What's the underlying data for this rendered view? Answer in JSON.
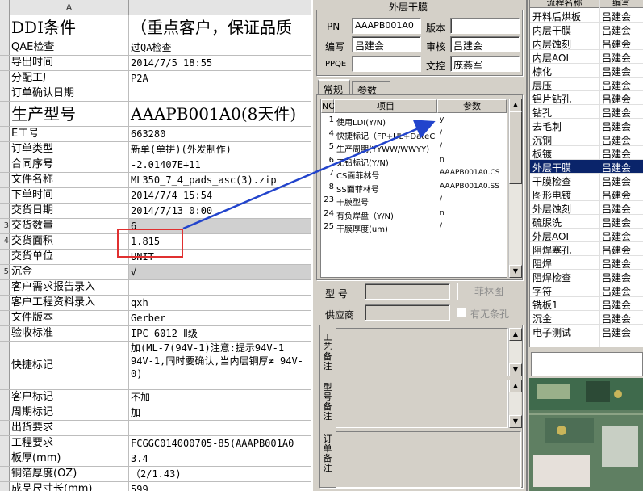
{
  "sheet": {
    "column_header": "A",
    "rows": [
      {
        "num": "",
        "label": "DDI条件",
        "value": "（重点客户，保证品质",
        "style": "big"
      },
      {
        "num": "",
        "label": "QAE检查",
        "value": "过QA检查"
      },
      {
        "num": "",
        "label": "导出时间",
        "value": "2014/7/5 18:55"
      },
      {
        "num": "",
        "label": "分配工厂",
        "value": "P2A"
      },
      {
        "num": "",
        "label": "订单确认日期",
        "value": ""
      },
      {
        "num": "",
        "label": "生产型号",
        "value": "AAAPB001A0(8天件)",
        "style": "big"
      },
      {
        "num": "",
        "label": "E工号",
        "value": "663280"
      },
      {
        "num": "",
        "label": "订单类型",
        "value": "新单(单拼)(外发制作)"
      },
      {
        "num": "",
        "label": "合同序号",
        "value": "-2.01407E+11"
      },
      {
        "num": "",
        "label": "文件名称",
        "value": "ML350_7_4_pads_asc(3).zip"
      },
      {
        "num": "",
        "label": "下单时间",
        "value": "2014/7/4 15:54"
      },
      {
        "num": "",
        "label": "交货日期",
        "value": "2014/7/13 0:00"
      },
      {
        "num": "3",
        "label": "交货数量",
        "value": "6",
        "style": "gray"
      },
      {
        "num": "4",
        "label": "交货面积",
        "value": "1.815"
      },
      {
        "num": "",
        "label": "交货单位",
        "value": "UNIT"
      },
      {
        "num": "5",
        "label": "沉金",
        "value": "√",
        "style": "gray"
      },
      {
        "num": "",
        "label": "客户需求报告录入",
        "value": ""
      },
      {
        "num": "",
        "label": "客户工程资料录入",
        "value": "qxh"
      },
      {
        "num": "",
        "label": "文件版本",
        "value": "Gerber"
      },
      {
        "num": "",
        "label": "验收标准",
        "value": "IPC-6012 Ⅱ级"
      },
      {
        "num": "",
        "label": "快捷标记",
        "value": "加(ML-7(94V-1)注意:提示94V-1 94V-1,同时要确认,当内层铜厚≠ 94V-0)",
        "style": "tall"
      },
      {
        "num": "",
        "label": "客户标记",
        "value": "不加"
      },
      {
        "num": "",
        "label": "周期标记",
        "value": "加"
      },
      {
        "num": "",
        "label": "出货要求",
        "value": ""
      },
      {
        "num": "",
        "label": "工程要求",
        "value": "FCGGC014000705-85(AAAPB001A0"
      },
      {
        "num": "",
        "label": "板厚(mm)",
        "value": "3.4"
      },
      {
        "num": "",
        "label": "铜箔厚度(OZ)",
        "value": "（2/1.43)"
      },
      {
        "num": "",
        "label": "成品尺寸长(mm)",
        "value": "599"
      }
    ]
  },
  "dialog": {
    "title": "外层干膜",
    "pn_label": "PN",
    "pn_value": "AAAPB001A0",
    "version_label": "版本",
    "version_value": "",
    "editor_label": "编写",
    "editor_value": "吕建会",
    "reviewer_label": "审核",
    "reviewer_value": "吕建会",
    "ppqe_label": "PPQE",
    "ppqe_value": "",
    "proof_label": "文控",
    "proof_value": "庞燕军",
    "tabs": [
      "常规",
      "参数"
    ],
    "grid": {
      "headers": [
        "NO",
        "项目",
        "参数"
      ],
      "rows": [
        {
          "no": "1",
          "item": "使用LDI(Y/N)",
          "param": "y"
        },
        {
          "no": "4",
          "item": "快捷标记（FP+UL+DateC",
          "param": "/"
        },
        {
          "no": "5",
          "item": "生产周期(YYWW/WWYY)",
          "param": "/"
        },
        {
          "no": "6",
          "item": "无铅标记(Y/N)",
          "param": "n"
        },
        {
          "no": "7",
          "item": "CS面菲林号",
          "param": "AAAPB001A0.CS"
        },
        {
          "no": "8",
          "item": "SS面菲林号",
          "param": "AAAPB001A0.SS"
        },
        {
          "no": "23",
          "item": "干膜型号",
          "param": "/"
        },
        {
          "no": "24",
          "item": "有负焊盘（Y/N)",
          "param": "n"
        },
        {
          "no": "25",
          "item": "干膜厚度(um)",
          "param": "/"
        }
      ]
    },
    "model_label": "型  号",
    "supplier_label": "供应商",
    "film_button": "菲林图",
    "no_strip_label": "有无条孔",
    "memo_labels": [
      "工艺备注",
      "型号备注",
      "订单备注"
    ]
  },
  "process": {
    "headers": [
      "流程名称",
      "编写"
    ],
    "rows": [
      {
        "name": "开料后烘板",
        "author": "吕建会"
      },
      {
        "name": "内层干膜",
        "author": "吕建会"
      },
      {
        "name": "内层蚀刻",
        "author": "吕建会"
      },
      {
        "name": "内层AOI",
        "author": "吕建会"
      },
      {
        "name": "棕化",
        "author": "吕建会"
      },
      {
        "name": "层压",
        "author": "吕建会"
      },
      {
        "name": "铝片钻孔",
        "author": "吕建会"
      },
      {
        "name": "钻孔",
        "author": "吕建会"
      },
      {
        "name": "去毛刺",
        "author": "吕建会"
      },
      {
        "name": "沉铜",
        "author": "吕建会"
      },
      {
        "name": "板镀",
        "author": "吕建会"
      },
      {
        "name": "外层干膜",
        "author": "吕建会",
        "selected": true
      },
      {
        "name": "干膜检查",
        "author": "吕建会"
      },
      {
        "name": "图形电镀",
        "author": "吕建会"
      },
      {
        "name": "外层蚀刻",
        "author": "吕建会"
      },
      {
        "name": "硫脲洗",
        "author": "吕建会"
      },
      {
        "name": "外层AOI",
        "author": "吕建会"
      },
      {
        "name": "阻焊塞孔",
        "author": "吕建会"
      },
      {
        "name": "阻焊",
        "author": "吕建会"
      },
      {
        "name": "阻焊检查",
        "author": "吕建会"
      },
      {
        "name": "字符",
        "author": "吕建会"
      },
      {
        "name": "铣板1",
        "author": "吕建会"
      },
      {
        "name": "沉金",
        "author": "吕建会"
      },
      {
        "name": "电子测试",
        "author": "吕建会"
      }
    ]
  },
  "colors": {
    "annotation_box": "#e03030",
    "arrow": "#2244cc",
    "selection": "#0a246a"
  }
}
